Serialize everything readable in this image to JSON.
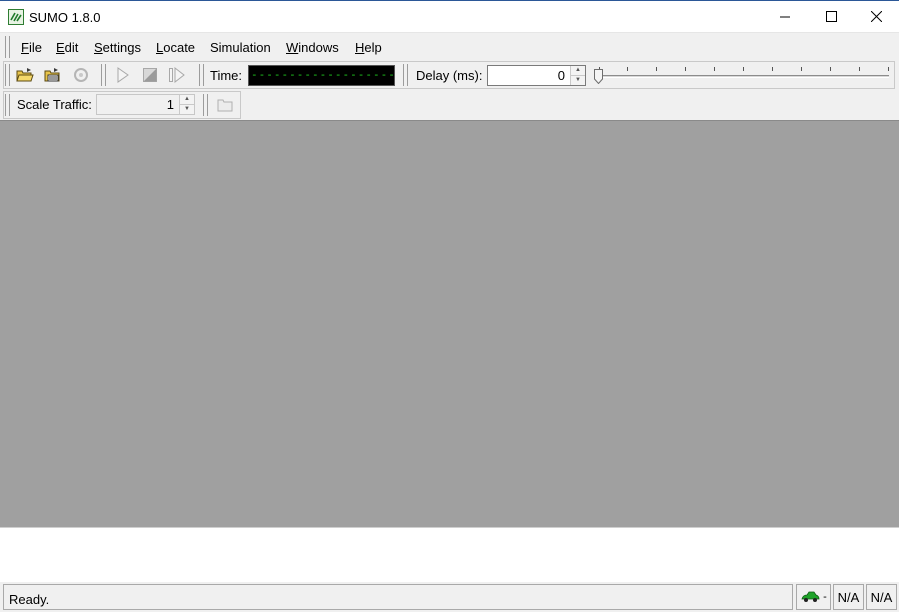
{
  "window": {
    "title": "SUMO 1.8.0",
    "controls": [
      "minimize-icon",
      "maximize-icon",
      "close-icon"
    ]
  },
  "menubar": {
    "items": [
      {
        "label": "File",
        "key": "F"
      },
      {
        "label": "Edit",
        "key": "E"
      },
      {
        "label": "Settings",
        "key": "S"
      },
      {
        "label": "Locate",
        "key": "L"
      },
      {
        "label": "Simulation",
        "key": ""
      },
      {
        "label": "Windows",
        "key": "W"
      },
      {
        "label": "Help",
        "key": "H"
      }
    ]
  },
  "toolbar": {
    "icons": [
      "open-simulation-icon",
      "open-network-icon",
      "reload-icon",
      "run-icon",
      "stop-icon",
      "step-icon"
    ],
    "time_label": "Time:",
    "time_display": "--------------------",
    "delay_label": "Delay (ms):",
    "delay_value": "0",
    "scale_label": "Scale Traffic:",
    "scale_value": "1",
    "edit_icon": "new-view-icon"
  },
  "statusbar": {
    "message": "Ready.",
    "vehicle_icon": "car-icon",
    "vehicle_dash": "-",
    "cell1": "N/A",
    "cell2": "N/A"
  },
  "colors": {
    "canvas_bg": "#a0a0a0",
    "lcd_bg": "#000000",
    "lcd_text": "#21d121",
    "chrome_bg": "#f0f0f0"
  }
}
